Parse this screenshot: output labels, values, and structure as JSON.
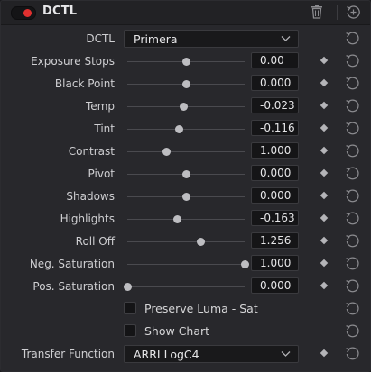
{
  "header": {
    "title": "DCTL",
    "enabled": true,
    "toggle_color": "#e0302f",
    "icons": [
      "power-toggle",
      "trash-icon",
      "reset-all-icon"
    ]
  },
  "dctl": {
    "label": "DCTL",
    "value": "Primera"
  },
  "sliders": [
    {
      "label": "Exposure Stops",
      "value": "0.00",
      "level": 0.5
    },
    {
      "label": "Black Point",
      "value": "0.000",
      "level": 0.5
    },
    {
      "label": "Temp",
      "value": "-0.023",
      "level": 0.48
    },
    {
      "label": "Tint",
      "value": "-0.116",
      "level": 0.44
    },
    {
      "label": "Contrast",
      "value": "1.000",
      "level": 0.33
    },
    {
      "label": "Pivot",
      "value": "0.000",
      "level": 0.5
    },
    {
      "label": "Shadows",
      "value": "0.000",
      "level": 0.5
    },
    {
      "label": "Highlights",
      "value": "-0.163",
      "level": 0.42
    },
    {
      "label": "Roll Off",
      "value": "1.256",
      "level": 0.62
    },
    {
      "label": "Neg. Saturation",
      "value": "1.000",
      "level": 1.0
    },
    {
      "label": "Pos. Saturation",
      "value": "0.000",
      "level": 0.0
    }
  ],
  "checkboxes": [
    {
      "label": "Preserve Luma - Sat",
      "checked": false
    },
    {
      "label": "Show Chart",
      "checked": false
    }
  ],
  "transfer_function": {
    "label": "Transfer Function",
    "value": "ARRI LogC4"
  }
}
